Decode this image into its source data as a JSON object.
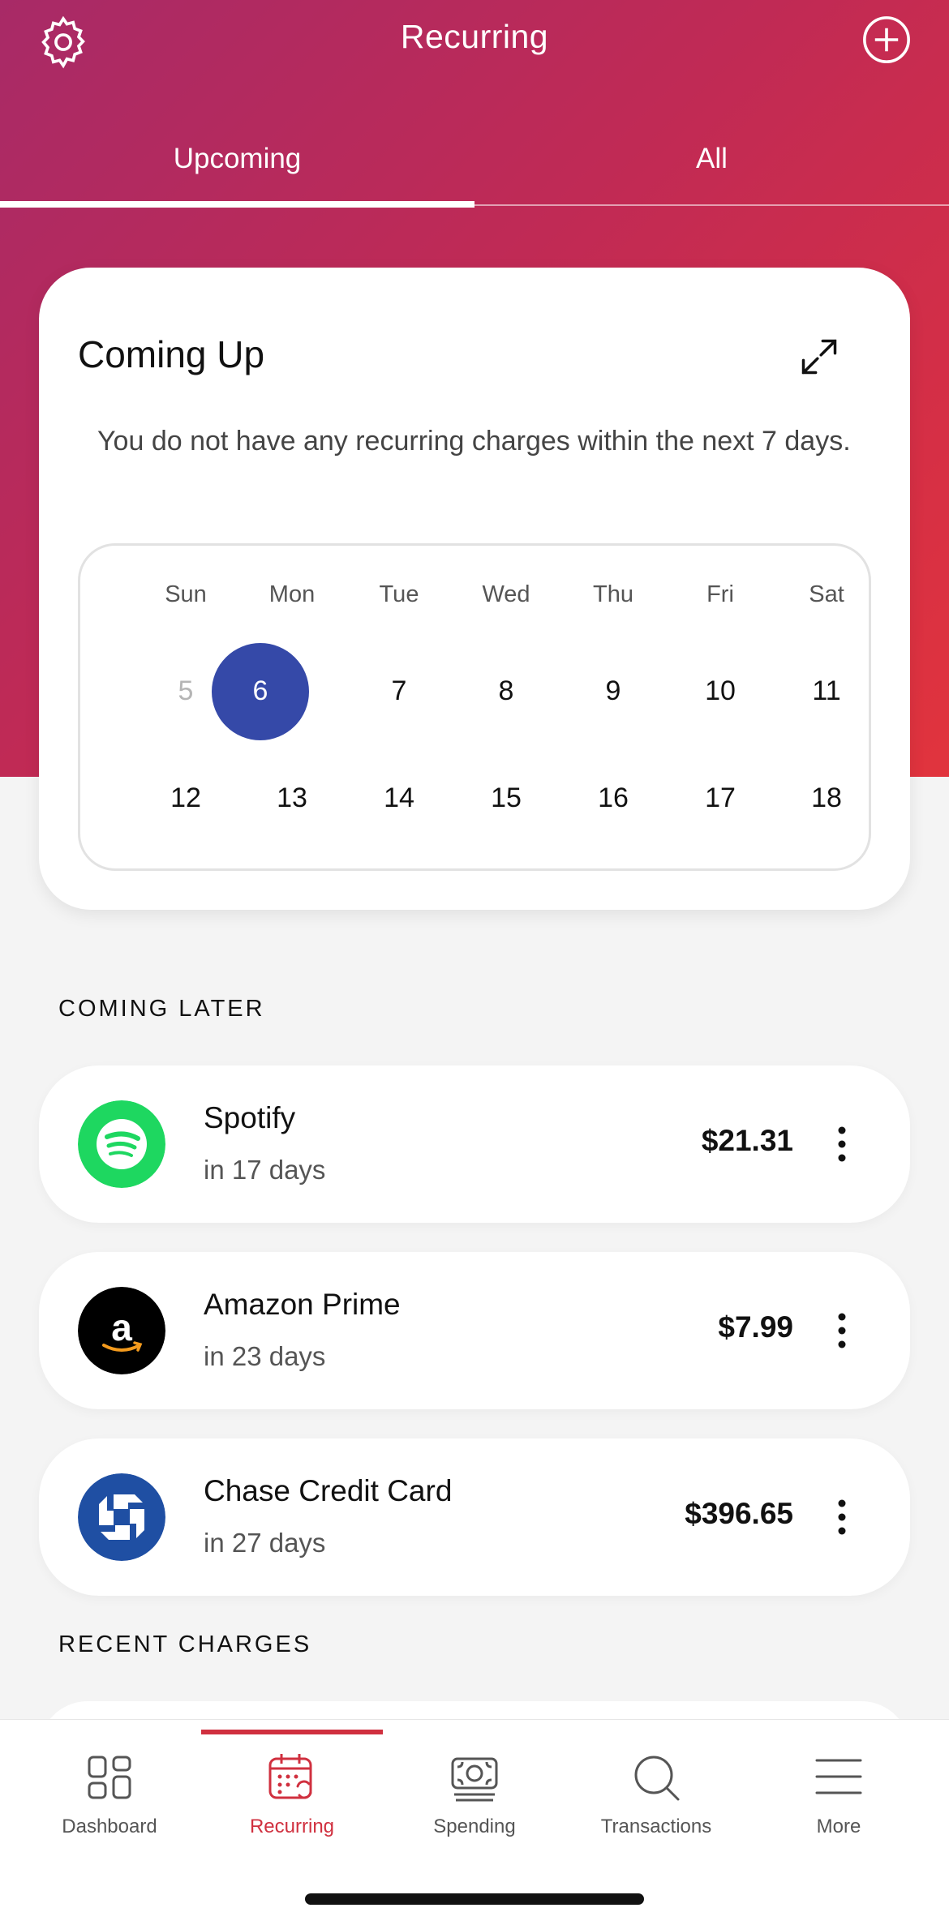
{
  "header": {
    "title": "Recurring",
    "tabs": [
      {
        "label": "Upcoming",
        "active": true
      },
      {
        "label": "All",
        "active": false
      }
    ]
  },
  "coming_up": {
    "title": "Coming Up",
    "message": "You do not have any recurring charges within the next 7 days.",
    "calendar": {
      "weekdays": [
        "Sun",
        "Mon",
        "Tue",
        "Wed",
        "Thu",
        "Fri",
        "Sat"
      ],
      "week1": [
        "5",
        "6",
        "7",
        "8",
        "9",
        "10",
        "11"
      ],
      "week2": [
        "12",
        "13",
        "14",
        "15",
        "16",
        "17",
        "18"
      ],
      "today": "6",
      "past": [
        "5"
      ]
    }
  },
  "coming_later": {
    "label": "COMING LATER",
    "items": [
      {
        "name": "Spotify",
        "when": "in 17 days",
        "amount": "$21.31",
        "logo_icon": "spotify-icon",
        "logo_color": "#1ed760"
      },
      {
        "name": "Amazon Prime",
        "when": "in 23 days",
        "amount": "$7.99",
        "logo_icon": "amazon-icon",
        "logo_color": "#000000"
      },
      {
        "name": "Chase Credit Card",
        "when": "in 27 days",
        "amount": "$396.65",
        "logo_icon": "chase-icon",
        "logo_color": "#1f4fa3"
      }
    ]
  },
  "recent_charges": {
    "label": "RECENT CHARGES"
  },
  "nav": {
    "items": [
      {
        "label": "Dashboard",
        "icon": "dashboard-icon"
      },
      {
        "label": "Recurring",
        "icon": "recurring-calendar-icon",
        "active": true
      },
      {
        "label": "Spending",
        "icon": "spending-icon"
      },
      {
        "label": "Transactions",
        "icon": "search-icon"
      },
      {
        "label": "More",
        "icon": "menu-icon"
      }
    ]
  },
  "colors": {
    "accent": "#d0303f",
    "today": "#3549a8",
    "gradient_start": "#a82a67",
    "gradient_end": "#e1343d"
  }
}
